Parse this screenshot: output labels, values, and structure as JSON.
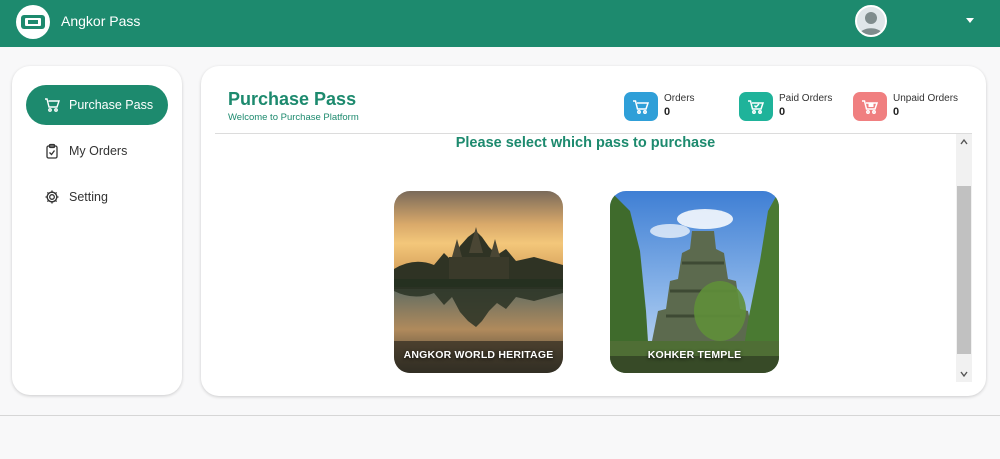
{
  "app": {
    "title": "Angkor Pass"
  },
  "user": {
    "name": ""
  },
  "sidebar": {
    "items": [
      {
        "label": "Purchase Pass",
        "icon": "cart-icon",
        "active": true
      },
      {
        "label": "My Orders",
        "icon": "clipboard-check-icon",
        "active": false
      },
      {
        "label": "Setting",
        "icon": "gear-icon",
        "active": false
      }
    ]
  },
  "header": {
    "title": "Purchase Pass",
    "subtitle": "Welcome to Purchase Platform"
  },
  "stats": [
    {
      "label": "Orders",
      "value": "0",
      "color": "#2f9fd8"
    },
    {
      "label": "Paid Orders",
      "value": "0",
      "color": "#1fb39a"
    },
    {
      "label": "Unpaid Orders",
      "value": "0",
      "color": "#f07f80"
    }
  ],
  "content": {
    "prompt": "Please select which pass to purchase",
    "passes": [
      {
        "label": "ANGKOR WORLD HERITAGE"
      },
      {
        "label": "KOHKER TEMPLE"
      }
    ]
  },
  "colors": {
    "brand": "#1d8a6e"
  }
}
